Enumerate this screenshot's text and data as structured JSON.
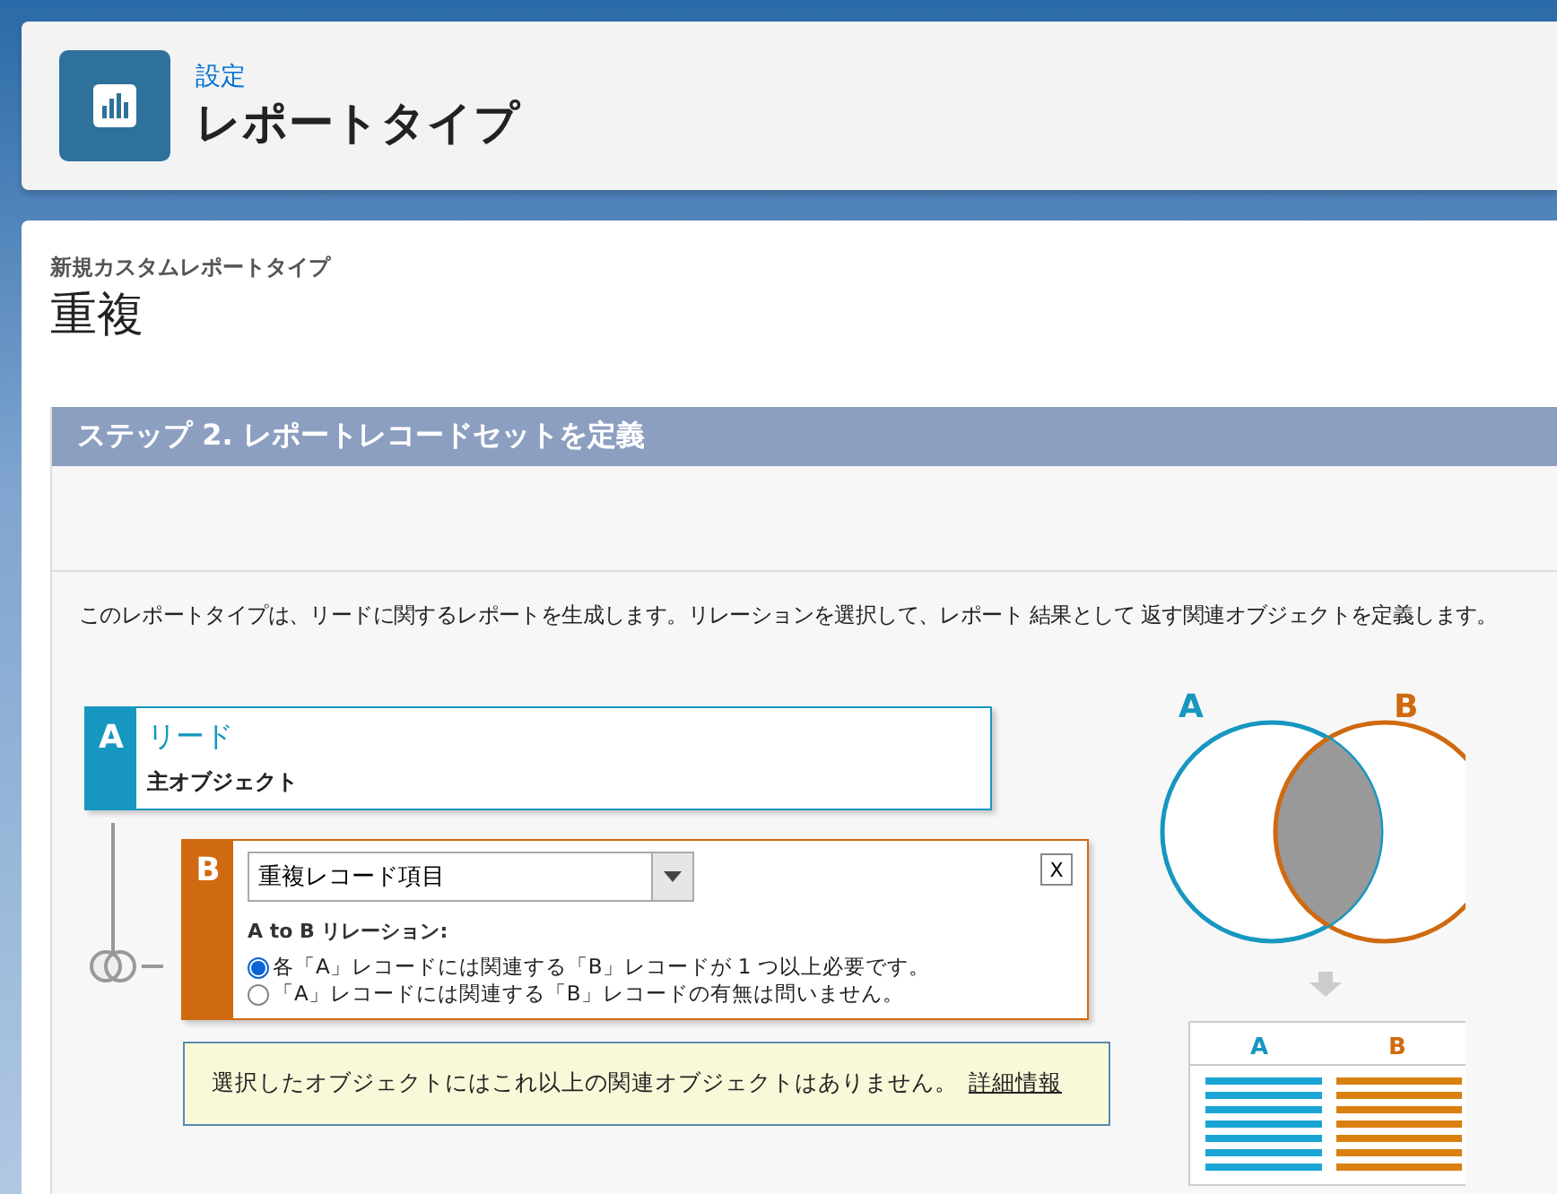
{
  "header": {
    "breadcrumb": "設定",
    "title": "レポートタイプ"
  },
  "page": {
    "subtitle": "新規カスタムレポートタイプ",
    "title": "重複"
  },
  "step": {
    "title": "ステップ 2. レポートレコードセットを定義",
    "description": "このレポートタイプは、リードに関するレポートを生成します。リレーションを選択して、レポート 結果として 返す関連オブジェクトを定義します。"
  },
  "object_a": {
    "letter": "A",
    "name": "リード",
    "role": "主オブジェクト"
  },
  "object_b": {
    "letter": "B",
    "select_value": "重複レコード項目",
    "close": "X",
    "relation_label": "A to B リレーション:",
    "options": [
      {
        "label": "各「A」レコードには関連する「B」レコードが 1 つ以上必要です。",
        "selected": true
      },
      {
        "label": "「A」レコードには関連する「B」レコードの有無は問いません。",
        "selected": false
      }
    ]
  },
  "notice": {
    "text": "選択したオブジェクトにはこれ以上の関連オブジェクトはありません。",
    "link": "詳細情報"
  },
  "diagram": {
    "label_a": "A",
    "label_b": "B",
    "column_a": "A",
    "column_b": "B"
  }
}
